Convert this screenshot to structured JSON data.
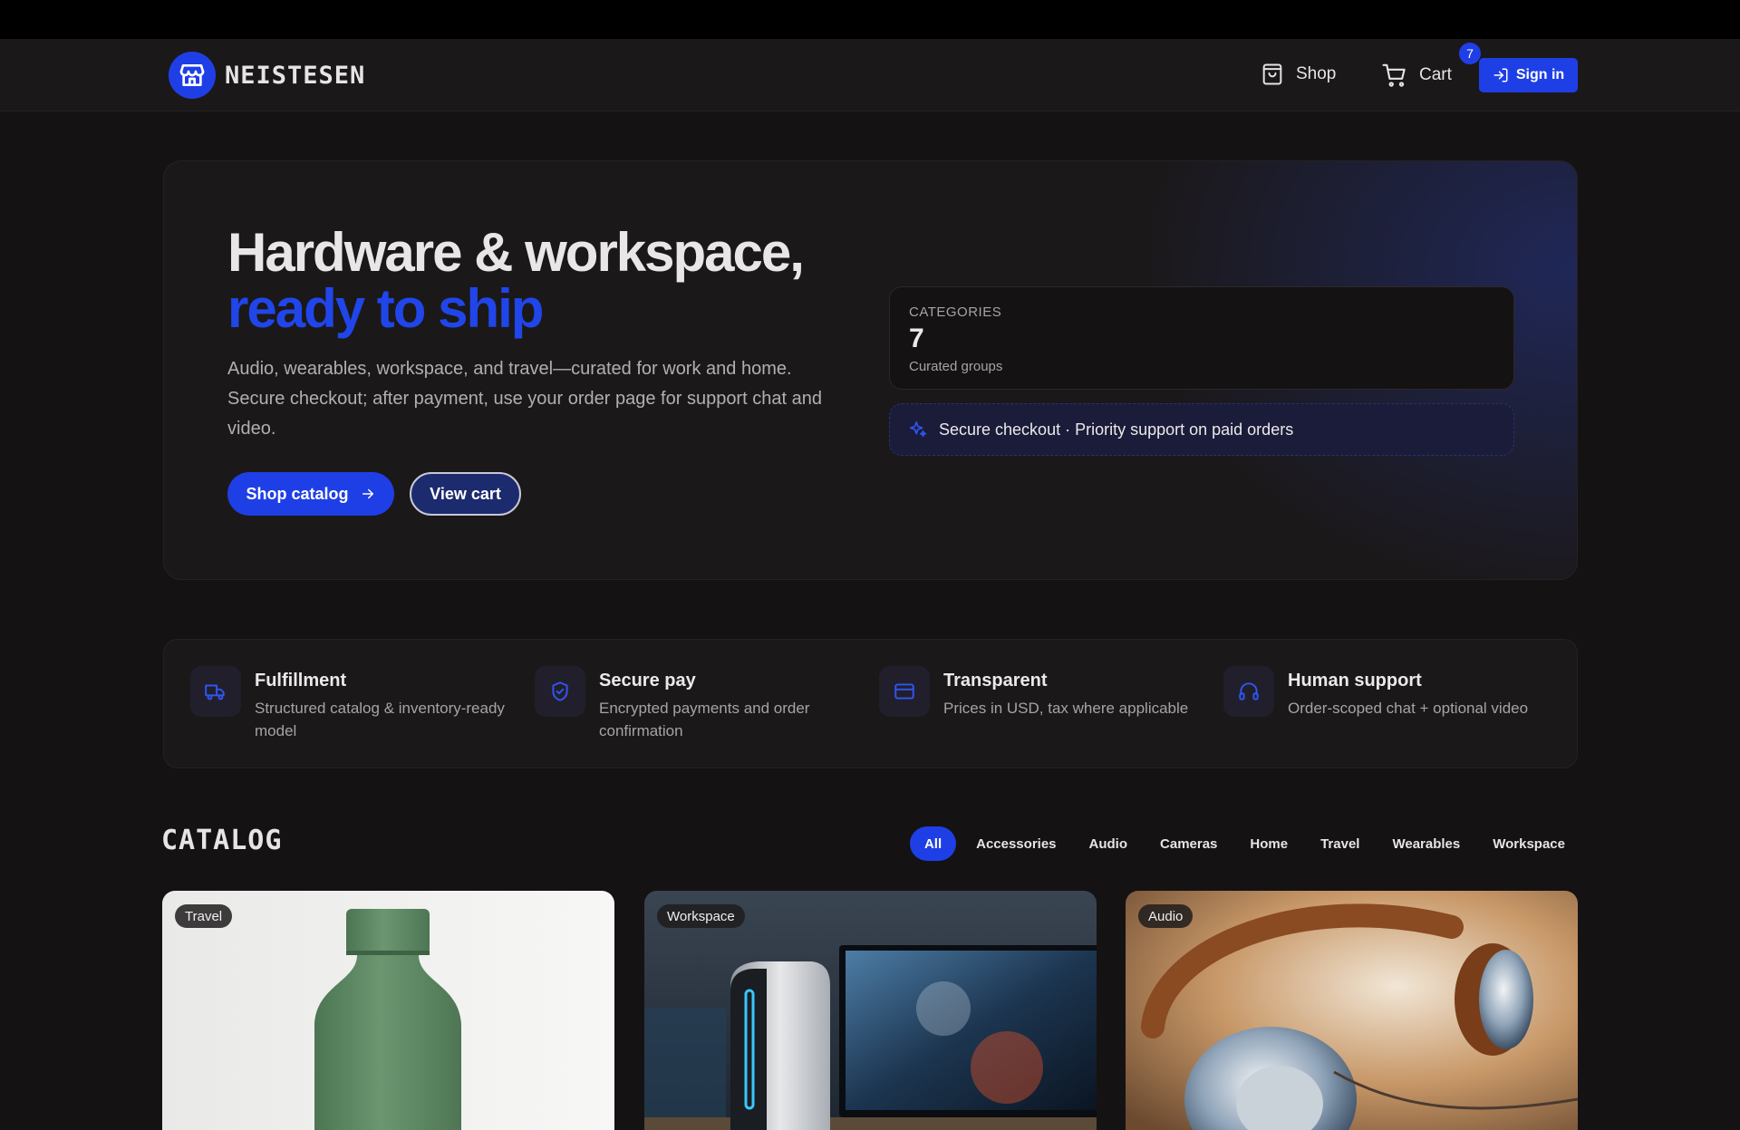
{
  "brand": {
    "name": "NEISTESEN",
    "icon": "store-icon"
  },
  "nav": {
    "shop_label": "Shop",
    "cart_label": "Cart",
    "cart_count": "7",
    "signin_label": "Sign in"
  },
  "hero": {
    "title_line1": "Hardware & workspace,",
    "title_line2": "ready to ship",
    "subtitle": "Audio, wearables, workspace, and travel—curated for work and home. Secure checkout; after payment, use your order page for support chat and video.",
    "primary_cta": "Shop catalog",
    "secondary_cta": "View cart",
    "stat_label": "CATEGORIES",
    "stat_value": "7",
    "stat_desc": "Curated groups",
    "secure_note": "Secure checkout · Priority support on paid orders"
  },
  "features": [
    {
      "title": "Fulfillment",
      "desc": "Structured catalog & inventory-ready model",
      "icon": "truck-icon"
    },
    {
      "title": "Secure pay",
      "desc": "Encrypted payments and order confirmation",
      "icon": "shield-icon"
    },
    {
      "title": "Transparent",
      "desc": "Prices in USD, tax where applicable",
      "icon": "credit-card-icon"
    },
    {
      "title": "Human support",
      "desc": "Order-scoped chat + optional video",
      "icon": "headphones-icon"
    }
  ],
  "catalog": {
    "title": "CATALOG",
    "filters": [
      "All",
      "Accessories",
      "Audio",
      "Cameras",
      "Home",
      "Travel",
      "Wearables",
      "Workspace"
    ],
    "active_filter": "All",
    "products": [
      {
        "tag": "Travel"
      },
      {
        "tag": "Workspace"
      },
      {
        "tag": "Audio"
      }
    ]
  },
  "colors": {
    "accent": "#1f3fe6",
    "background": "#151213",
    "surface": "#1b1819"
  }
}
